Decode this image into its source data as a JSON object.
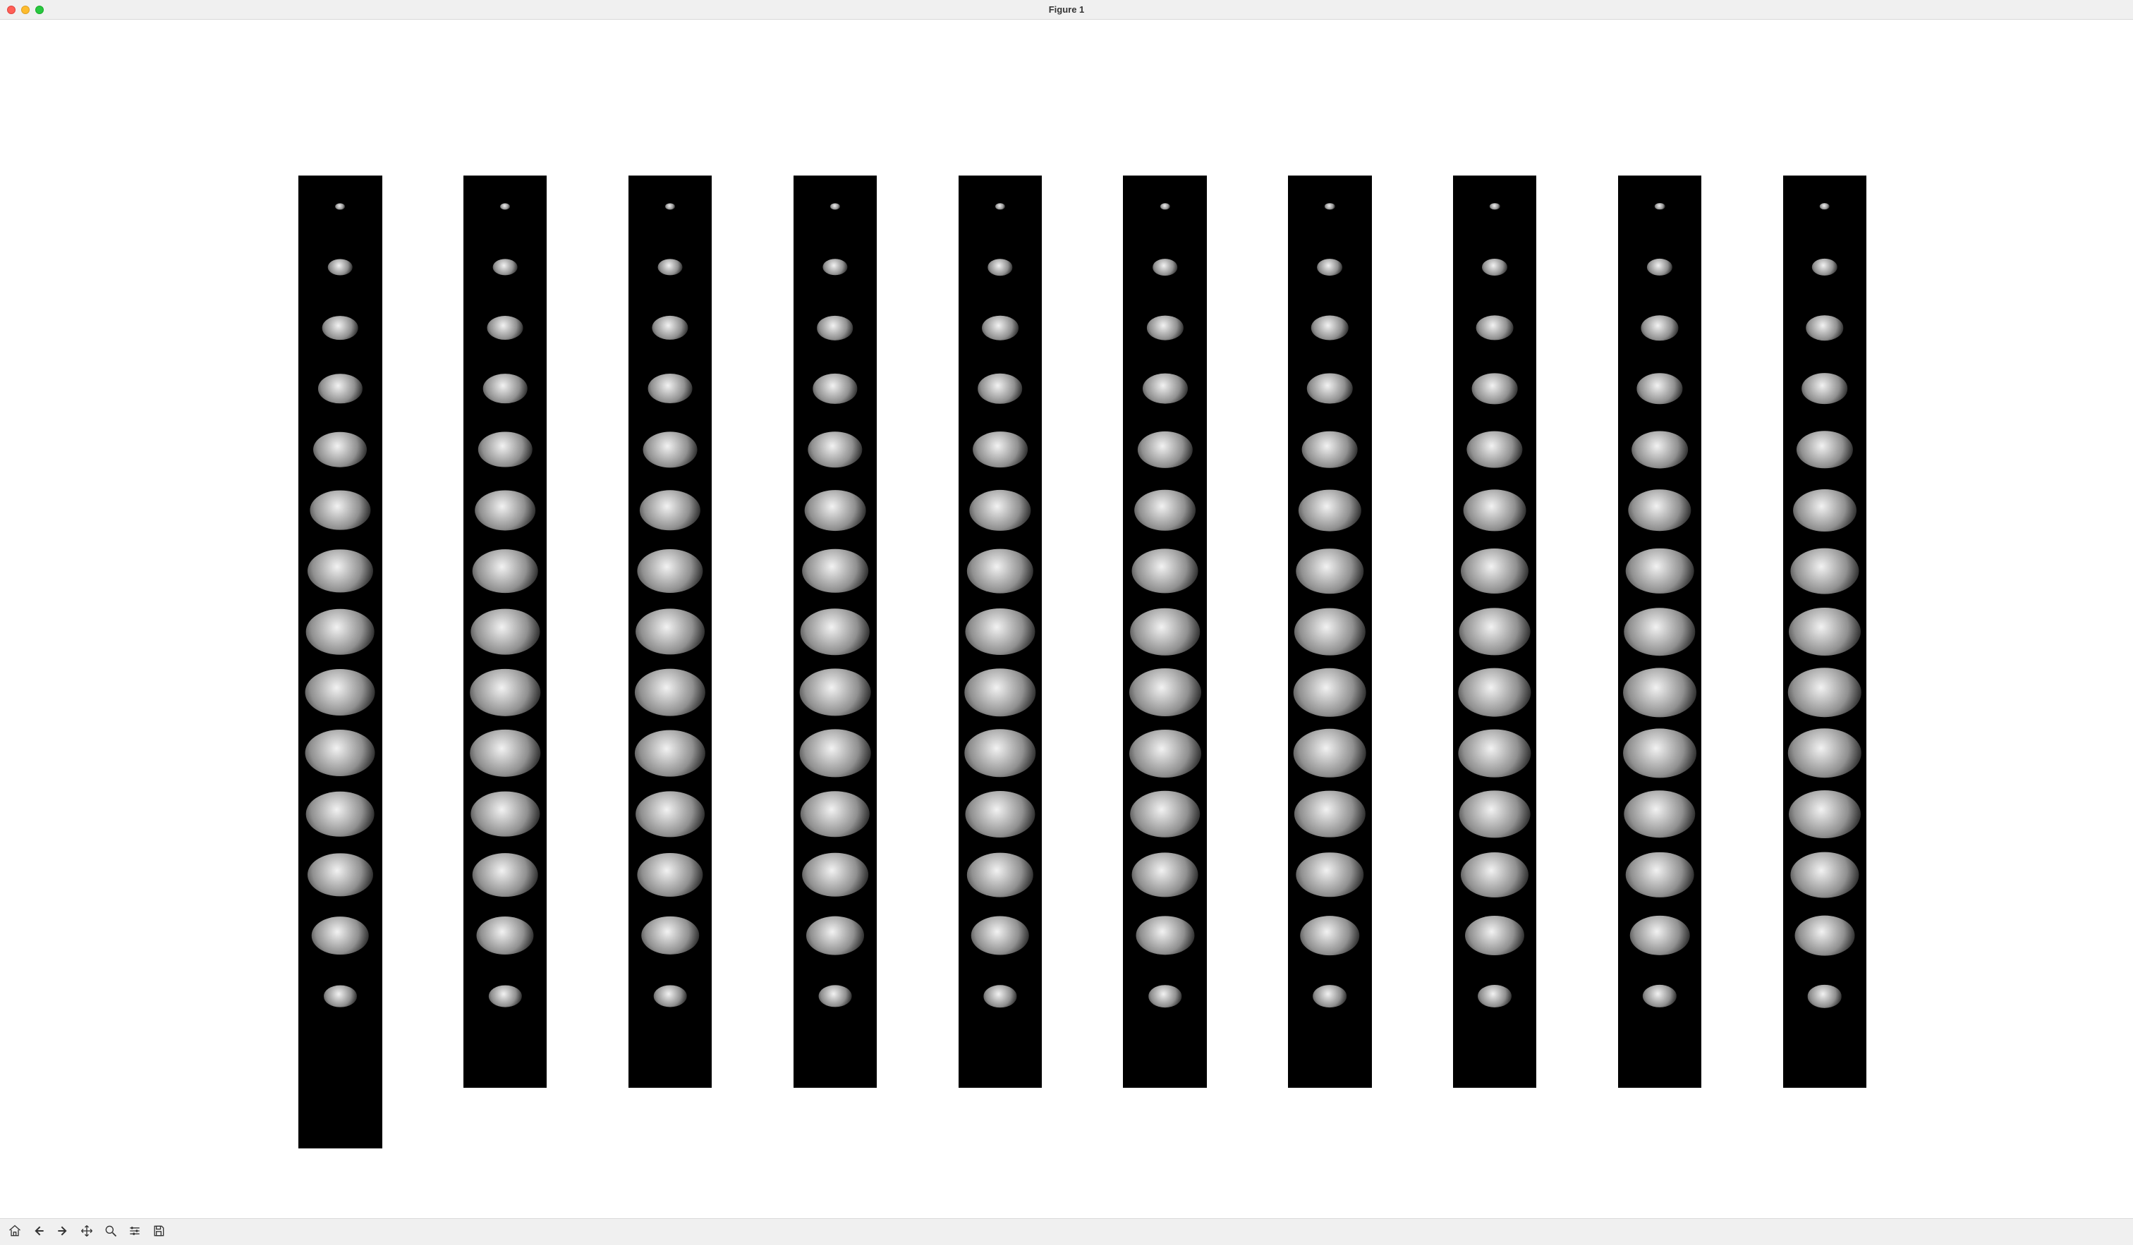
{
  "window": {
    "title": "Figure 1"
  },
  "figure": {
    "grid": {
      "rows": 16,
      "cols": 10,
      "last_row_only_first": true,
      "slice_sizes_percent_by_row": [
        12,
        30,
        44,
        54,
        66,
        74,
        80,
        84,
        86,
        86,
        84,
        80,
        70,
        40,
        0,
        0
      ]
    }
  },
  "toolbar": {
    "buttons": [
      {
        "id": "home",
        "label": "Home",
        "icon": "home-icon"
      },
      {
        "id": "back",
        "label": "Back",
        "icon": "arrow-left-icon"
      },
      {
        "id": "forward",
        "label": "Forward",
        "icon": "arrow-right-icon"
      },
      {
        "id": "pan",
        "label": "Pan",
        "icon": "move-icon"
      },
      {
        "id": "zoom",
        "label": "Zoom",
        "icon": "magnifier-icon"
      },
      {
        "id": "subplots",
        "label": "Configure subplots",
        "icon": "sliders-icon"
      },
      {
        "id": "save",
        "label": "Save",
        "icon": "save-icon"
      }
    ]
  }
}
